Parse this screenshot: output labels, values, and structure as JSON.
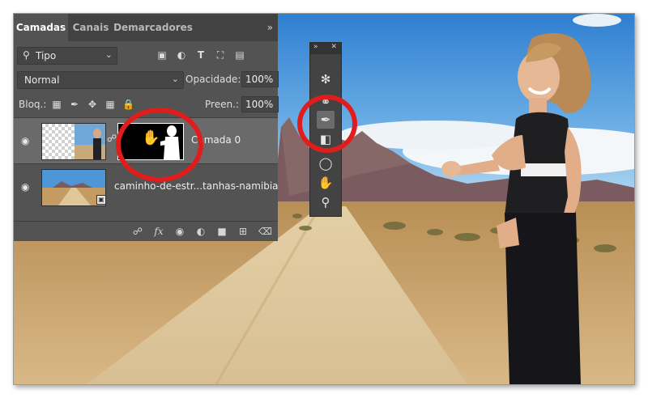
{
  "panel": {
    "tabs": [
      "Camadas",
      "Canais",
      "Demarcadores"
    ],
    "menu_icon": "»",
    "filter": {
      "value": "Tipo",
      "icons": [
        "image-icon",
        "adjustment-icon",
        "type-icon",
        "shape-icon",
        "smart-object-icon"
      ]
    },
    "blend_mode": "Normal",
    "opacity_label": "Opacidade:",
    "opacity_value": "100%",
    "lock_label": "Bloq.:",
    "fill_label": "Preen.:",
    "fill_value": "100%",
    "layers": [
      {
        "name": "Camada 0",
        "selected": true,
        "has_mask": true
      },
      {
        "name": "caminho-de-estr...tanhas-namibia",
        "selected": false,
        "has_mask": false
      }
    ]
  },
  "colors": {
    "panel_bg": "#535353",
    "highlight_ring": "#e01d1d",
    "sky": "#3f8fd6"
  }
}
